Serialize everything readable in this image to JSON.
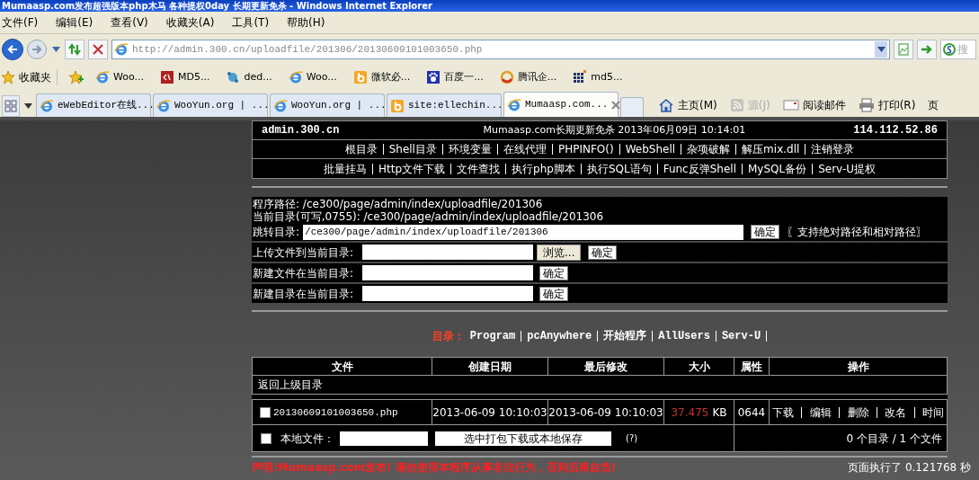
{
  "browser": {
    "title": "Mumaasp.com发布超强版本php木马 各种提权0day 长期更新免杀 - Windows Internet Explorer",
    "menu": [
      "文件(F)",
      "编辑(E)",
      "查看(V)",
      "收藏夹(A)",
      "工具(T)",
      "帮助(H)"
    ],
    "address": "http://admin.300.cn/uploadfile/201306/20130609101003650.php",
    "search_placeholder": "搜",
    "favorites_label": "收藏夹",
    "favorites": [
      {
        "kind": "ie",
        "label": "Woo..."
      },
      {
        "kind": "code",
        "label": "MD5..."
      },
      {
        "kind": "dede",
        "label": "ded..."
      },
      {
        "kind": "ie",
        "label": "Woo..."
      },
      {
        "kind": "bing",
        "label": "微软必..."
      },
      {
        "kind": "paw",
        "label": "百度一..."
      },
      {
        "kind": "ring",
        "label": "腾讯企..."
      },
      {
        "kind": "grid",
        "label": "md5..."
      }
    ],
    "tabs": [
      {
        "kind": "ie",
        "label": "eWebEditor在线...",
        "selected": false
      },
      {
        "kind": "ie",
        "label": "WooYun.org | ...",
        "selected": false
      },
      {
        "kind": "ie",
        "label": "WooYun.org | ...",
        "selected": false
      },
      {
        "kind": "bing",
        "label": "site:ellechin...",
        "selected": false
      },
      {
        "kind": "ie",
        "label": "Mumaasp.com...",
        "selected": true
      }
    ],
    "commands": [
      {
        "kind": "home",
        "label": "主页(M)",
        "disabled": false
      },
      {
        "kind": "feed",
        "label": "源(J)",
        "disabled": true
      },
      {
        "kind": "mail",
        "label": "阅读邮件",
        "disabled": false
      },
      {
        "kind": "print",
        "label": "打印(R)",
        "disabled": false
      },
      {
        "kind": "page",
        "label": "页",
        "disabled": false
      }
    ]
  },
  "page": {
    "header": {
      "host": "admin.300.cn",
      "slogan": "Mumaasp.com长期更新免杀 2013年06月09日 10:14:01",
      "ip": "114.112.52.86"
    },
    "nav_rows": [
      [
        "根目录",
        "Shell目录",
        "环境变量",
        "在线代理",
        "PHPINFO()",
        "WebShell",
        "杂项破解",
        "解压mix.dll",
        "注销登录"
      ],
      [
        "批量挂马",
        "Http文件下载",
        "文件查找",
        "执行php脚本",
        "执行SQL语句",
        "Func反弹Shell",
        "MySQL备份",
        "Serv-U提权"
      ]
    ],
    "program_path": "程序路径: /ce300/page/admin/index/uploadfile/201306",
    "current_dir": "当前目录(可写,0755): /ce300/page/admin/index/uploadfile/201306",
    "jump": {
      "label": "跳转目录:",
      "value": "/ce300/page/admin/index/uploadfile/201306",
      "button": "确定",
      "note": "〖支持绝对路径和相对路径〗"
    },
    "upload": {
      "label": "上传文件到当前目录:",
      "browse": "浏览...",
      "button": "确定"
    },
    "new_file": {
      "label": "新建文件在当前目录:",
      "button": "确定"
    },
    "new_dir": {
      "label": "新建目录在当前目录:",
      "button": "确定"
    },
    "dirs": {
      "label": "目录：",
      "links": [
        "Program",
        "pcAnywhere",
        "开始程序",
        "AllUsers",
        "Serv-U"
      ]
    },
    "table": {
      "columns": [
        "文件",
        "创建日期",
        "最后修改",
        "大小",
        "属性",
        "操作"
      ],
      "parent_link": "返回上级目录",
      "rows": [
        {
          "checked": false,
          "name": "20130609101003650.php",
          "created": "2013-06-09 10:10:03",
          "modified": "2013-06-09 10:10:03",
          "size": "37.475",
          "unit": "KB",
          "perms": "0644",
          "actions": [
            "下载",
            "编辑",
            "删除",
            "改名",
            "时间"
          ]
        }
      ],
      "footer": {
        "checked": false,
        "local_label": "本地文件：",
        "pack_button": "选中打包下载或本地保存",
        "help": "(?)",
        "summary": "0 个目录 / 1 个文件"
      }
    },
    "notice": "声明:Mumaasp.com发布! 请勿使用本程序从事非法行为，否则后果自负!",
    "timing": "页面执行了 0.121768 秒"
  }
}
